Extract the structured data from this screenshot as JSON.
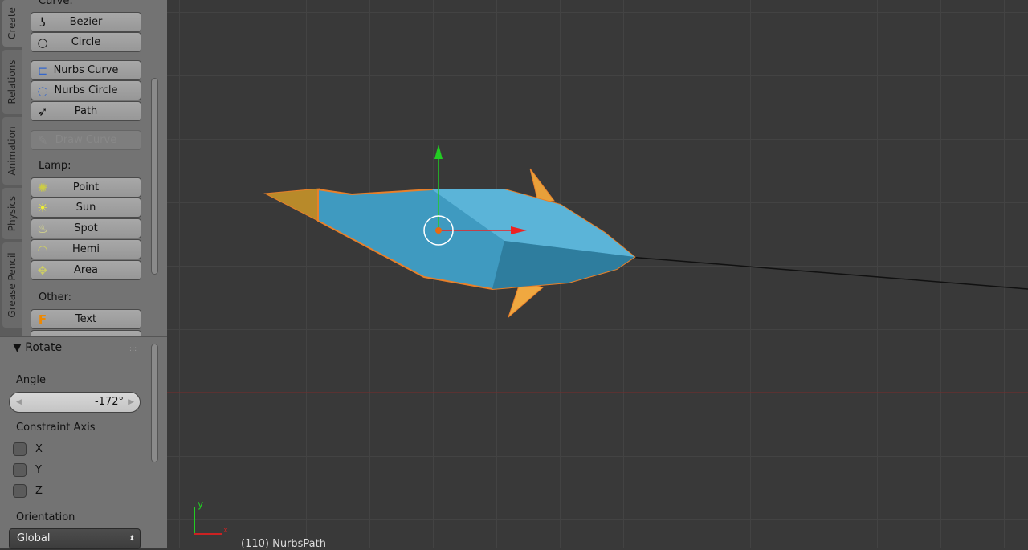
{
  "tabs": [
    "Create",
    "Relations",
    "Animation",
    "Physics",
    "Grease Pencil"
  ],
  "tools": {
    "curve_label": "Curve:",
    "curve_buttons": [
      "Bezier",
      "Circle"
    ],
    "nurbs_buttons": [
      "Nurbs Curve",
      "Nurbs Circle",
      "Path"
    ],
    "draw_curve": "Draw Curve",
    "lamp_label": "Lamp:",
    "lamp_buttons": [
      "Point",
      "Sun",
      "Spot",
      "Hemi",
      "Area"
    ],
    "other_label": "Other:",
    "other_buttons": [
      "Text"
    ]
  },
  "operator": {
    "title": "Rotate",
    "angle_label": "Angle",
    "angle_value": "-172°",
    "constraint_label": "Constraint Axis",
    "axes": [
      "X",
      "Y",
      "Z"
    ],
    "orientation_label": "Orientation",
    "orientation_value": "Global"
  },
  "viewport": {
    "object_info": "(110) NurbsPath",
    "axis_x": "x",
    "axis_y": "y"
  },
  "colors": {
    "selection": "#e8802a",
    "mesh": "#3f9ac0"
  }
}
